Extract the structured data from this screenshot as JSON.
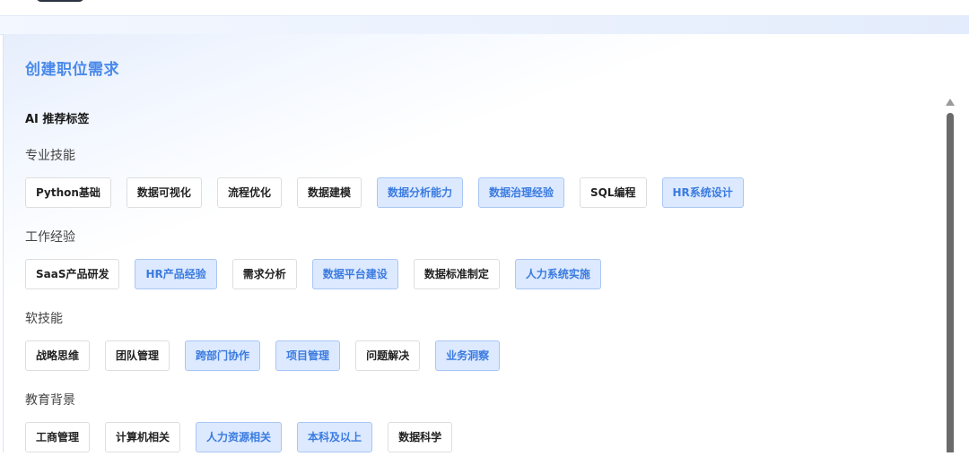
{
  "panel": {
    "title": "创建职位需求"
  },
  "ai_section": {
    "title": "AI 推荐标签"
  },
  "groups": [
    {
      "label": "专业技能",
      "tags": [
        {
          "label": "Python基础",
          "selected": false
        },
        {
          "label": "数据可视化",
          "selected": false
        },
        {
          "label": "流程优化",
          "selected": false
        },
        {
          "label": "数据建模",
          "selected": false
        },
        {
          "label": "数据分析能力",
          "selected": true
        },
        {
          "label": "数据治理经验",
          "selected": true
        },
        {
          "label": "SQL编程",
          "selected": false
        },
        {
          "label": "HR系统设计",
          "selected": true
        }
      ]
    },
    {
      "label": "工作经验",
      "tags": [
        {
          "label": "SaaS产品研发",
          "selected": false
        },
        {
          "label": "HR产品经验",
          "selected": true
        },
        {
          "label": "需求分析",
          "selected": false
        },
        {
          "label": "数据平台建设",
          "selected": true
        },
        {
          "label": "数据标准制定",
          "selected": false
        },
        {
          "label": "人力系统实施",
          "selected": true
        }
      ]
    },
    {
      "label": "软技能",
      "tags": [
        {
          "label": "战略思维",
          "selected": false
        },
        {
          "label": "团队管理",
          "selected": false
        },
        {
          "label": "跨部门协作",
          "selected": true
        },
        {
          "label": "项目管理",
          "selected": true
        },
        {
          "label": "问题解决",
          "selected": false
        },
        {
          "label": "业务洞察",
          "selected": true
        }
      ]
    },
    {
      "label": "教育背景",
      "tags": [
        {
          "label": "工商管理",
          "selected": false
        },
        {
          "label": "计算机相关",
          "selected": false
        },
        {
          "label": "人力资源相关",
          "selected": true
        },
        {
          "label": "本科及以上",
          "selected": true
        },
        {
          "label": "数据科学",
          "selected": false
        }
      ]
    }
  ],
  "colors": {
    "accent": "#4a89ea",
    "selected_bg": "#dce9ff",
    "selected_border": "#a9c6f5",
    "selected_text": "#3b7be0"
  },
  "icons": {
    "scroll_up": "chevron-up-icon"
  }
}
